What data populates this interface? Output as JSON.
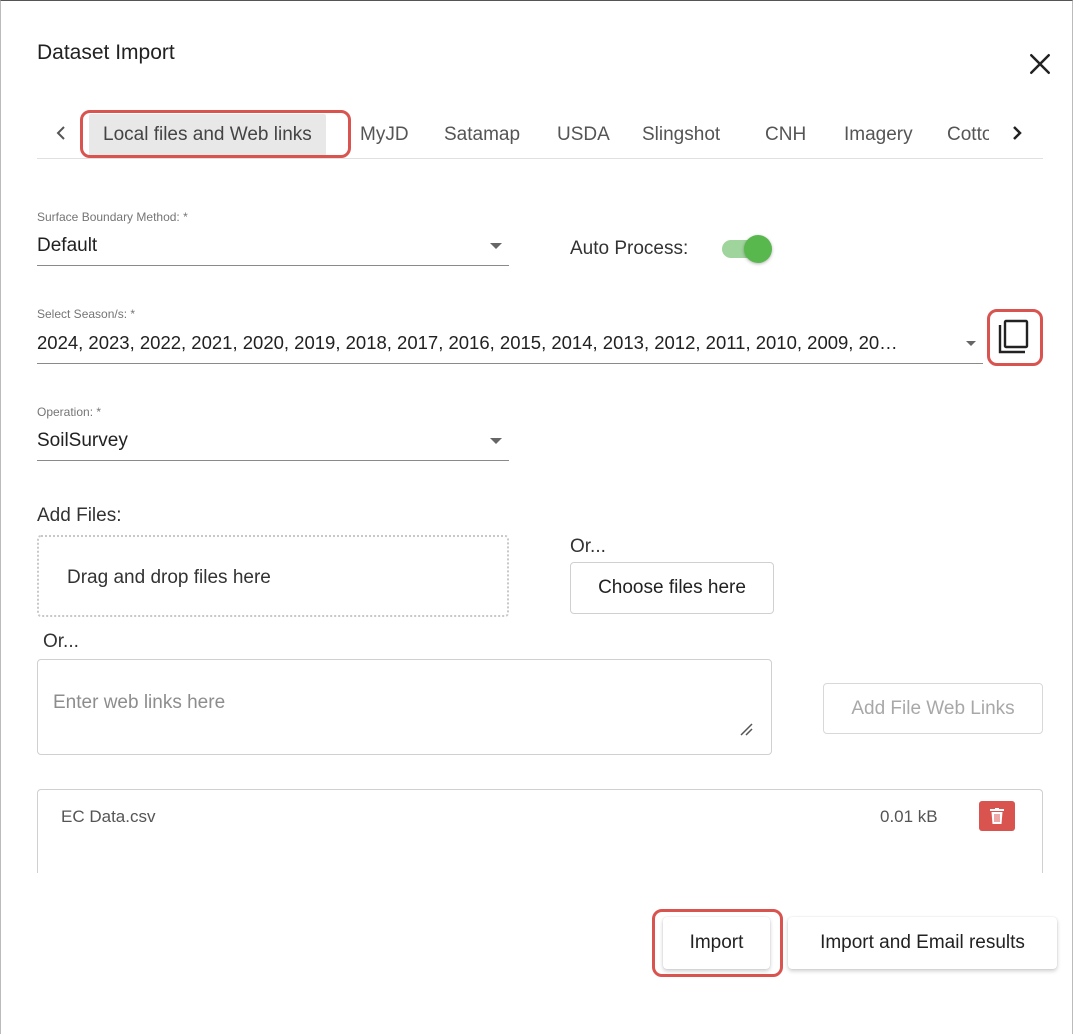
{
  "dialog": {
    "title": "Dataset Import",
    "close_icon": "close-icon"
  },
  "tabs": {
    "items": [
      {
        "label": "Local files and Web links",
        "active": true
      },
      {
        "label": "MyJD"
      },
      {
        "label": "Satamap"
      },
      {
        "label": "USDA"
      },
      {
        "label": "Slingshot"
      },
      {
        "label": "CNH"
      },
      {
        "label": "Imagery"
      },
      {
        "label": "Cotto"
      }
    ],
    "prev_icon": "chevron-left-icon",
    "next_icon": "chevron-right-icon"
  },
  "surface_boundary": {
    "label": "Surface Boundary Method: *",
    "value": "Default"
  },
  "auto_process": {
    "label": "Auto Process:",
    "enabled": true
  },
  "season": {
    "label": "Select Season/s: *",
    "value": "2024, 2023, 2022, 2021, 2020, 2019, 2018, 2017, 2016, 2015, 2014, 2013, 2012, 2011, 2010, 2009, 20…",
    "copy_icon": "copy-icon"
  },
  "operation": {
    "label": "Operation: *",
    "value": "SoilSurvey"
  },
  "add_files": {
    "label": "Add Files:",
    "dropzone_text": "Drag and drop files here",
    "or_text": "Or...",
    "choose_button": "Choose files here",
    "or_text_2": "Or...",
    "web_links_placeholder": "Enter web links here",
    "add_links_button": "Add File Web Links"
  },
  "files": [
    {
      "name": "EC Data.csv",
      "size": "0.01 kB"
    }
  ],
  "actions": {
    "import": "Import",
    "import_email": "Import and Email results"
  },
  "colors": {
    "highlight": "#d9534f",
    "toggle_on": "#58b84e",
    "delete": "#d9534f"
  }
}
